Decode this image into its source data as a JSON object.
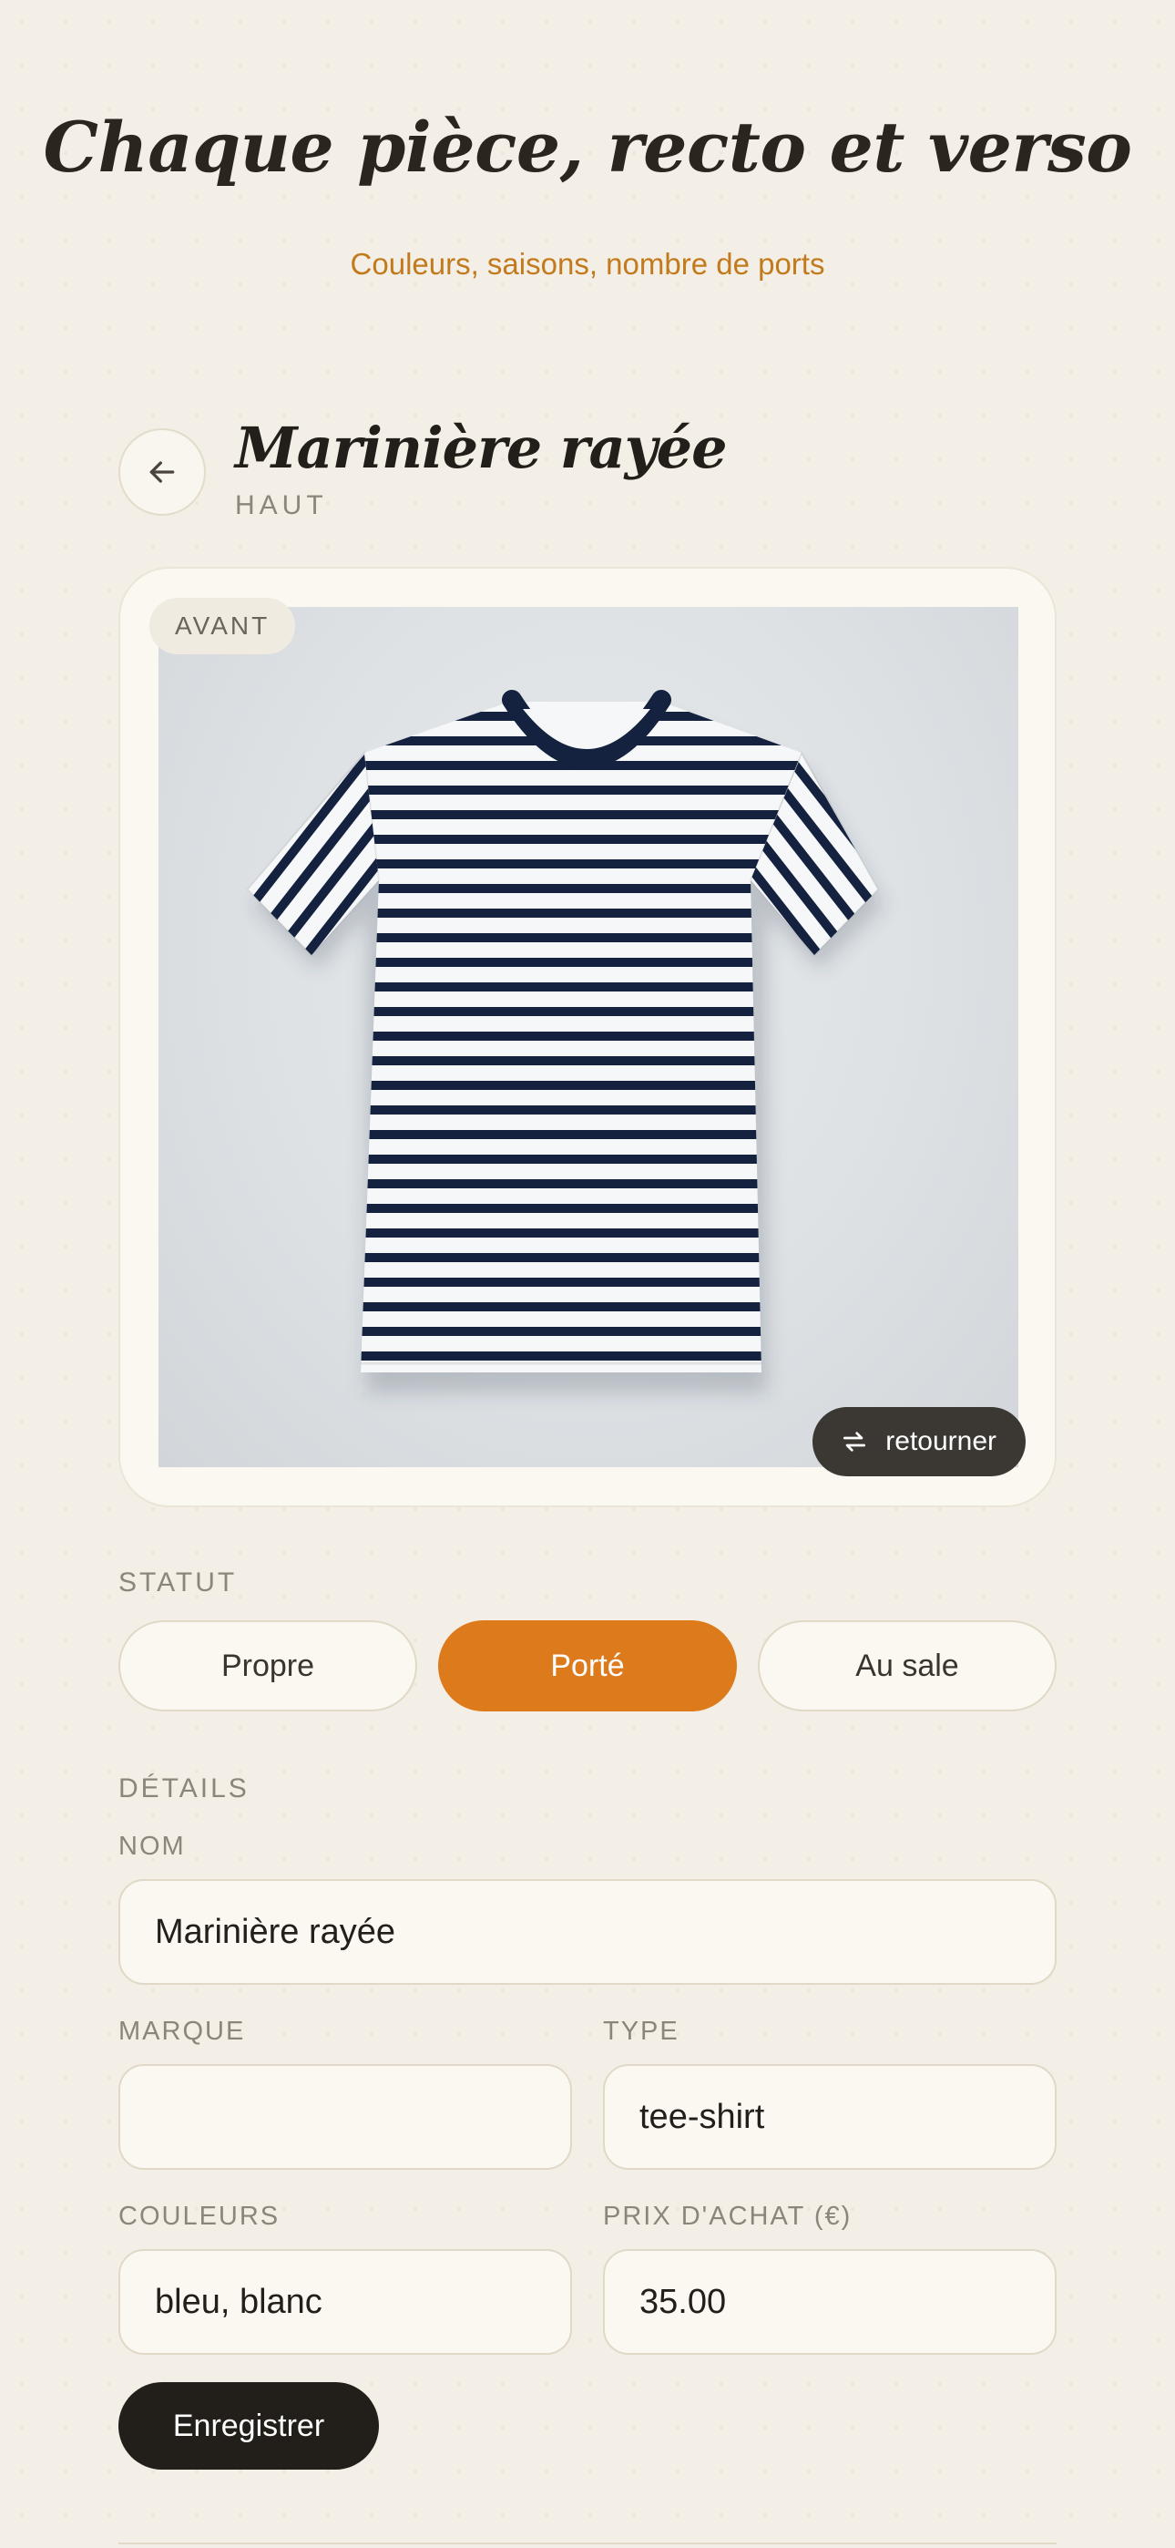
{
  "hero": {
    "title": "Chaque pièce, recto et verso",
    "subtitle": "Couleurs, saisons, nombre de ports"
  },
  "item": {
    "title": "Marinière rayée",
    "category": "HAUT",
    "side_label": "AVANT",
    "flip_label": "retourner",
    "back_icon": "arrow-left-icon",
    "flip_icon": "swap-icon"
  },
  "status": {
    "label": "STATUT",
    "options": [
      "Propre",
      "Porté",
      "Au sale"
    ],
    "selected": "Porté"
  },
  "details": {
    "label": "DÉTAILS",
    "name_label": "NOM",
    "name_value": "Marinière rayée",
    "brand_label": "MARQUE",
    "brand_value": "",
    "type_label": "TYPE",
    "type_value": "tee-shirt",
    "colors_label": "COULEURS",
    "colors_value": "bleu, blanc",
    "price_label": "PRIX D'ACHAT (€)",
    "price_value": "35.00"
  },
  "actions": {
    "save_label": "Enregistrer"
  },
  "colors": {
    "accent": "#dd7a1c",
    "subtitle": "#c27a1c",
    "dark_button": "#221f1b",
    "stripe_navy": "#14223f",
    "background": "#f3efe6"
  }
}
